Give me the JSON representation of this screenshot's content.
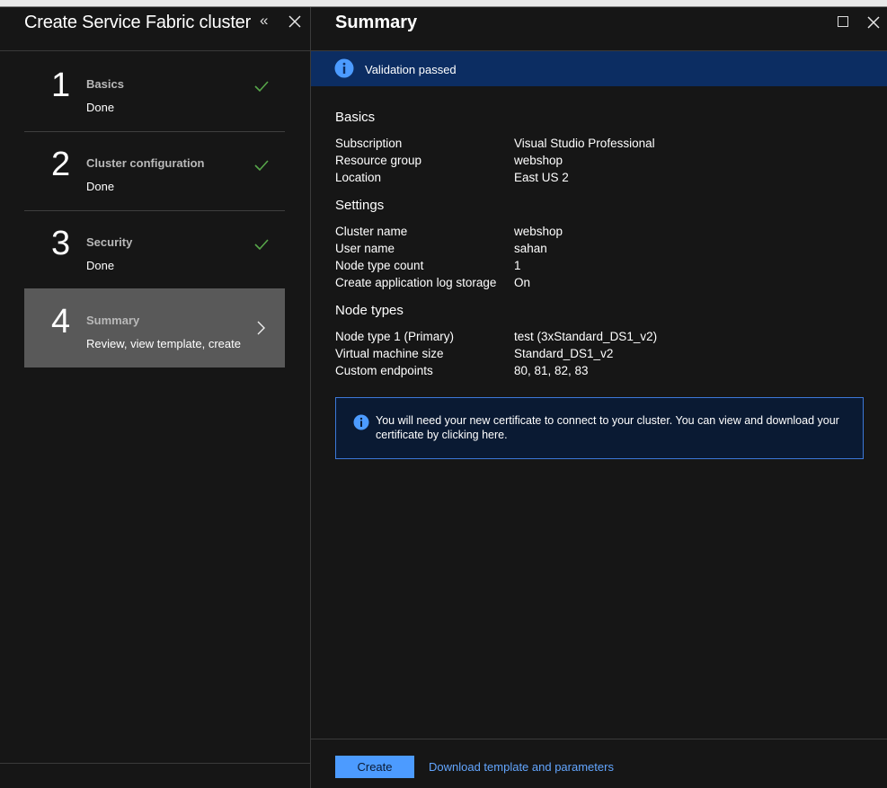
{
  "left": {
    "title": "Create Service Fabric cluster",
    "collapse_icon": "«",
    "steps": [
      {
        "number": "1",
        "title": "Basics",
        "subtitle": "Done",
        "state": "done"
      },
      {
        "number": "2",
        "title": "Cluster configuration",
        "subtitle": "Done",
        "state": "done"
      },
      {
        "number": "3",
        "title": "Security",
        "subtitle": "Done",
        "state": "done"
      },
      {
        "number": "4",
        "title": "Summary",
        "subtitle": "Review, view template, create",
        "state": "active"
      }
    ]
  },
  "right": {
    "title": "Summary",
    "validation": {
      "text": "Validation passed",
      "color": "#0c2d62"
    },
    "sections": {
      "basics": {
        "heading": "Basics",
        "rows": [
          {
            "label": "Subscription",
            "value": "Visual Studio Professional"
          },
          {
            "label": "Resource group",
            "value": "webshop"
          },
          {
            "label": "Location",
            "value": "East US 2"
          }
        ]
      },
      "settings": {
        "heading": "Settings",
        "rows": [
          {
            "label": "Cluster name",
            "value": "webshop"
          },
          {
            "label": "User name",
            "value": "sahan"
          },
          {
            "label": "Node type count",
            "value": "1"
          },
          {
            "label": "Create application log storage",
            "value": "On"
          }
        ]
      },
      "node_types": {
        "heading": "Node types",
        "rows": [
          {
            "label": "Node type 1 (Primary)",
            "value": "test (3xStandard_DS1_v2)"
          },
          {
            "label": "Virtual machine size",
            "value": "Standard_DS1_v2"
          },
          {
            "label": "Custom endpoints",
            "value": "80, 81, 82, 83"
          }
        ]
      }
    },
    "certificate_notice": "You will need your new certificate to connect to your cluster. You can view and download your certificate by clicking here.",
    "footer": {
      "create_label": "Create",
      "download_label": "Download template and parameters"
    }
  },
  "colors": {
    "background": "#161616",
    "accent_blue": "#4c9bff",
    "check_green": "#57a64a",
    "active_step": "#595959"
  },
  "icons": {
    "collapse": "double-chevron-left-icon",
    "close": "close-icon",
    "maximize": "maximize-icon",
    "check": "checkmark-icon",
    "chevron": "chevron-right-icon",
    "info": "info-icon"
  }
}
